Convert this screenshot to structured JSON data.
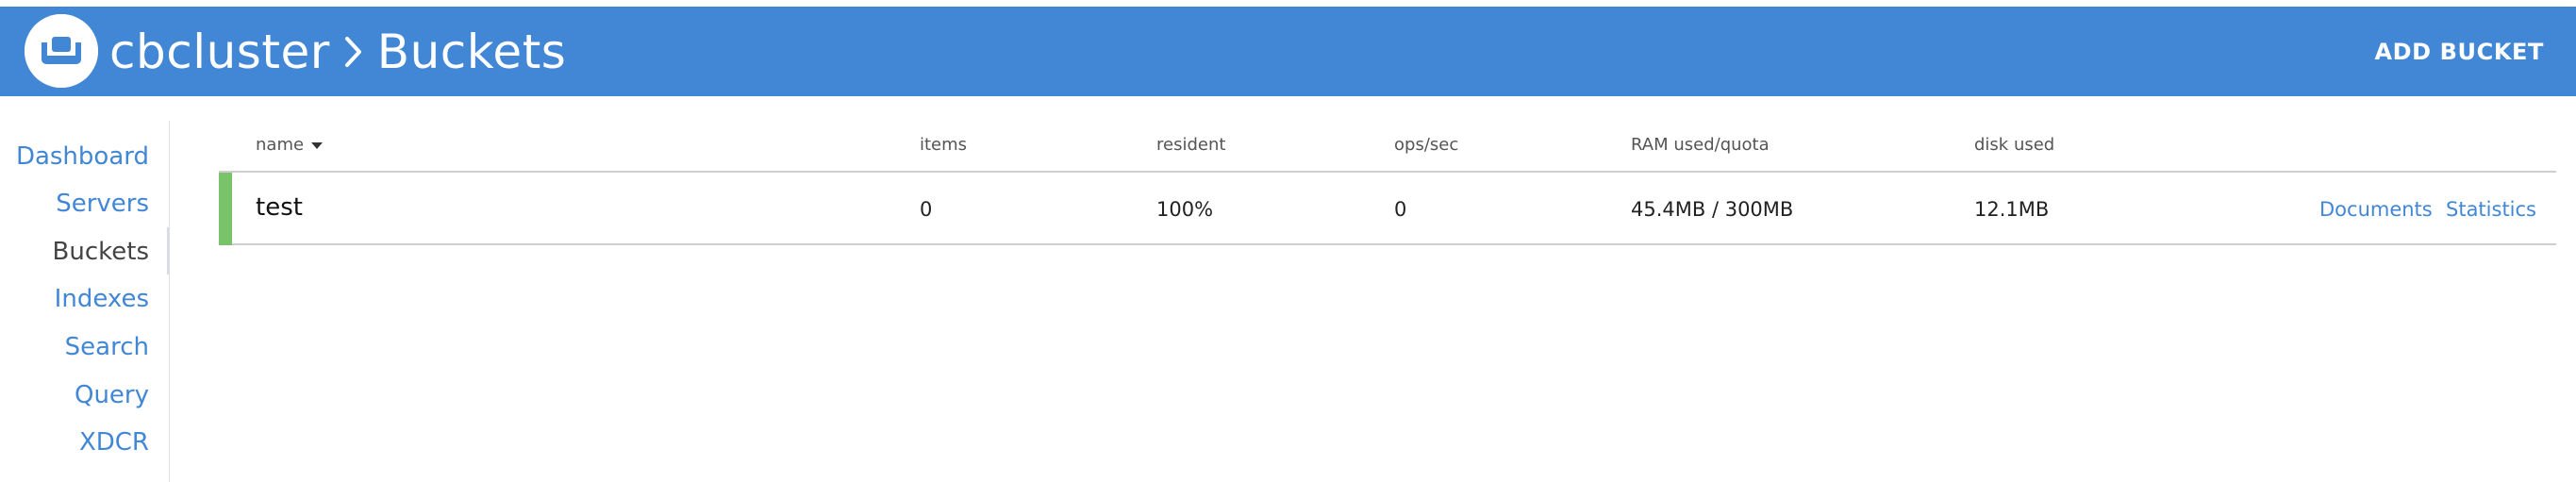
{
  "header": {
    "cluster_name": "cbcluster",
    "page_title": "Buckets",
    "add_bucket_label": "ADD BUCKET",
    "background_color": "#4287d6"
  },
  "sidebar": {
    "items": [
      {
        "label": "Dashboard",
        "active": false
      },
      {
        "label": "Servers",
        "active": false
      },
      {
        "label": "Buckets",
        "active": true
      },
      {
        "label": "Indexes",
        "active": false
      },
      {
        "label": "Search",
        "active": false
      },
      {
        "label": "Query",
        "active": false
      },
      {
        "label": "XDCR",
        "active": false
      }
    ],
    "link_color": "#4287d6"
  },
  "table": {
    "columns": {
      "name": "name",
      "items": "items",
      "resident": "resident",
      "ops": "ops/sec",
      "ram": "RAM used/quota",
      "disk": "disk used"
    },
    "sort_column": "name",
    "rows": [
      {
        "name": "test",
        "items": "0",
        "resident": "100%",
        "ops": "0",
        "ram": "45.4MB / 300MB",
        "disk": "12.1MB",
        "status_color": "#79c46a",
        "documents_link": "Documents",
        "statistics_link": "Statistics"
      }
    ]
  }
}
